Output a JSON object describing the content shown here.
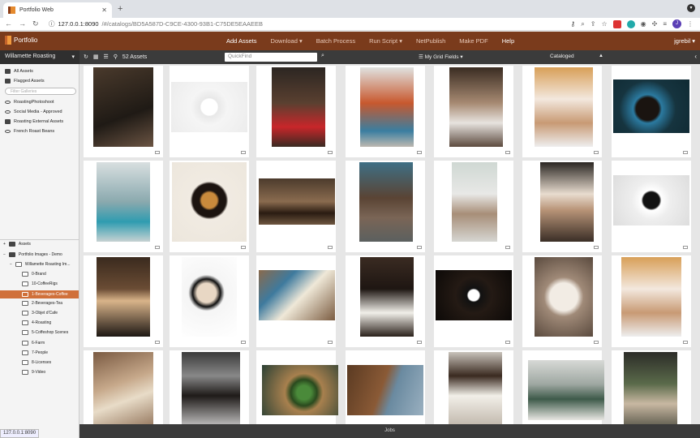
{
  "browser": {
    "tab_title": "Portfolio Web",
    "new_tab": "+",
    "url_host": "127.0.0.1:8090",
    "url_path": "/#/catalogs/BD5A587D-C9CE-4300-93B1-C75DE5EAAEEB",
    "profile_initial": "J",
    "hover_url": "127.0.0.1:8090"
  },
  "app": {
    "logo_text": "Portfolio",
    "nav": {
      "add_assets": "Add Assets",
      "download": "Download ▾",
      "batch_process": "Batch Process",
      "run_script": "Run Script ▾",
      "netpublish": "NetPublish",
      "make_pdf": "Make PDF",
      "help": "Help"
    },
    "user": "jgrebil ▾"
  },
  "toolbar": {
    "catalog_name": "Willamette Roasting",
    "asset_count": "52 Assets",
    "quickfind_placeholder": "QuickFind",
    "grid_fields": "My Grid Fields",
    "sort_field": "Cataloged"
  },
  "sidebar": {
    "all_assets": "All Assets",
    "flagged_assets": "Flagged Assets",
    "filter_placeholder": "Filter Galleries",
    "galleries": [
      "RoastingPhotoshoot",
      "Social Media - Approved",
      "Roasting External Assets",
      "French Roast Beans"
    ],
    "tree": {
      "assets": "Assets",
      "portfolio_images": "Portfolio Images - Demo",
      "willamette": "Willamette Roasting Im...",
      "folders": [
        "0-Brand",
        "10-CoffeeRigs",
        "1-Beverages-Coffee",
        "2-Beverages-Tea",
        "3-Objet d'Cafe",
        "4-Roasting",
        "5-Coffeshop Scenes",
        "6-Farm",
        "7-People",
        "8-Licenses",
        "9-Video"
      ]
    }
  },
  "status": {
    "jobs": "Jobs"
  },
  "colors": {
    "brand": "#7a3b1c",
    "selected": "#d0703a",
    "toolbar": "#3b3b3b"
  }
}
